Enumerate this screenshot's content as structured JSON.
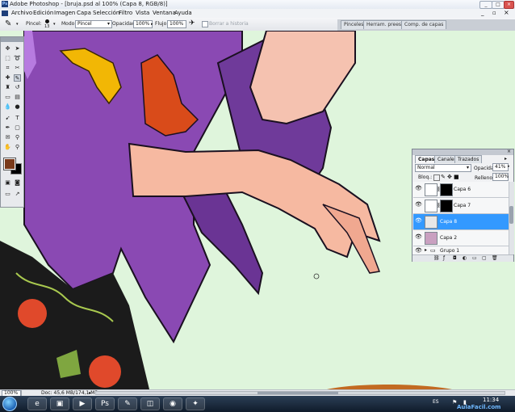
{
  "window": {
    "title": "Adobe Photoshop - [bruja.psd al 100% (Capa 8, RGB/8)]",
    "controls": [
      "_",
      "□",
      "×"
    ]
  },
  "menu": [
    "Archivo",
    "Edición",
    "Imagen",
    "Capa",
    "Selección",
    "Filtro",
    "Vista",
    "Ventana",
    "Ayuda"
  ],
  "options": {
    "brush_label": "Pincel:",
    "brush_size": "13",
    "mode_label": "Modo:",
    "mode_value": "Pincel",
    "opacity_label": "Opacidad:",
    "opacity_value": "100%",
    "flow_label": "Flujo:",
    "flow_value": "100%",
    "history_label": "Borrar a historia"
  },
  "dock_tabs": [
    "Pinceles",
    "Herram. preest.",
    "Comp. de capas"
  ],
  "layers_panel": {
    "tabs": [
      "Capas",
      "Canales",
      "Trazados"
    ],
    "blend_mode": "Normal",
    "opacity_label": "Opacidad:",
    "opacity_value": "41%",
    "lock_label": "Bloq.:",
    "fill_label": "Relleno:",
    "fill_value": "100%",
    "layers": [
      {
        "name": "Capa 6",
        "visible": true,
        "selected": false,
        "has_mask": true
      },
      {
        "name": "Capa 7",
        "visible": true,
        "selected": false,
        "has_mask": true
      },
      {
        "name": "Capa 8",
        "visible": true,
        "selected": true,
        "has_mask": false
      },
      {
        "name": "Capa 2",
        "visible": true,
        "selected": false,
        "has_mask": false
      },
      {
        "name": "Grupo 1",
        "visible": true,
        "selected": false,
        "has_mask": false,
        "is_group": true
      }
    ]
  },
  "status": {
    "zoom": "100%",
    "doc": "Doc: 45,6 MB/174,1 MB"
  },
  "taskbar": {
    "language": "ES",
    "time": "11:34",
    "watermark": "AulaFacil.com"
  },
  "colors": {
    "canvas_bg": "#dff5dc",
    "dress_purple": "#8a49b3",
    "skin": "#f6b9a1",
    "selection_blue": "#3399ff",
    "foreground": "#7a3a1a",
    "background": "#000000"
  }
}
